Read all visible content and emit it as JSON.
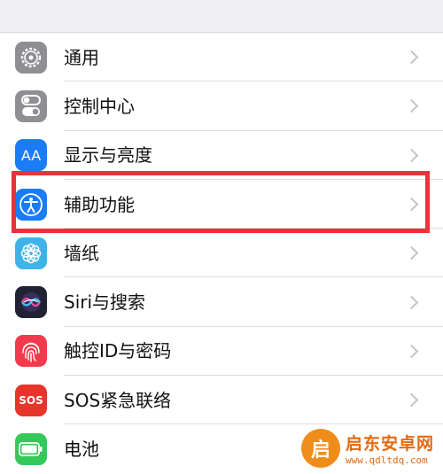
{
  "settings": {
    "items": [
      {
        "label": "通用",
        "icon": "gear-icon",
        "color": "#8e8e93"
      },
      {
        "label": "控制中心",
        "icon": "toggle-switches-icon",
        "color": "#8e8e93"
      },
      {
        "label": "显示与亮度",
        "icon": "text-size-icon",
        "color": "#1a7cf6",
        "icon_text": "AA"
      },
      {
        "label": "辅助功能",
        "icon": "accessibility-icon",
        "color": "#1a7cf6"
      },
      {
        "label": "墙纸",
        "icon": "flower-icon",
        "color": "#3fb3e8"
      },
      {
        "label": "Siri与搜索",
        "icon": "siri-icon",
        "color": "#222235"
      },
      {
        "label": "触控ID与密码",
        "icon": "fingerprint-icon",
        "color": "#f23a4c"
      },
      {
        "label": "SOS紧急联络",
        "icon": "sos-icon",
        "color": "#e6352b",
        "icon_text": "SOS"
      },
      {
        "label": "电池",
        "icon": "battery-icon",
        "color": "#34c759"
      }
    ]
  },
  "highlight": {
    "color": "#e8333b",
    "target": "辅助功能"
  },
  "watermark": {
    "logo_text": "启",
    "title": "启东安卓网",
    "url": "www.qdltdq.com"
  }
}
